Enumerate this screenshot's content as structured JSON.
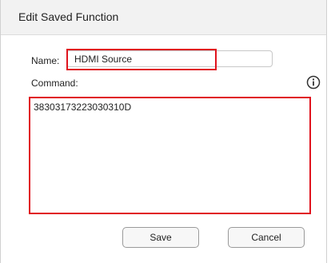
{
  "dialog": {
    "title": "Edit Saved Function"
  },
  "form": {
    "name_label": "Name:",
    "name_value": "HDMI Source",
    "command_label": "Command:",
    "command_value": "38303173223030310D",
    "info_icon": "info-circle-icon"
  },
  "buttons": {
    "save_label": "Save",
    "cancel_label": "Cancel"
  },
  "colors": {
    "highlight": "#e0141e",
    "titlebar_bg": "#f2f2f2"
  }
}
